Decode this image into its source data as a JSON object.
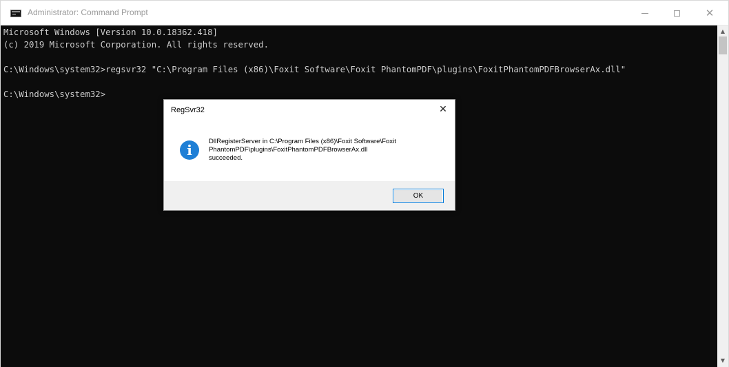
{
  "window": {
    "title": "Administrator: Command Prompt",
    "icon": "cmd-icon",
    "controls": {
      "minimize": "minimize-icon",
      "maximize": "maximize-icon",
      "close": "close-icon"
    }
  },
  "console": {
    "lines": [
      "Microsoft Windows [Version 10.0.18362.418]",
      "(c) 2019 Microsoft Corporation. All rights reserved.",
      "",
      "C:\\Windows\\system32>regsvr32 \"C:\\Program Files (x86)\\Foxit Software\\Foxit PhantomPDF\\plugins\\FoxitPhantomPDFBrowserAx.dll\"",
      "",
      "C:\\Windows\\system32>"
    ],
    "background": "#0c0c0c",
    "foreground": "#cccccc"
  },
  "dialog": {
    "title": "RegSvr32",
    "icon": "info-icon",
    "icon_glyph": "i",
    "icon_color": "#1e7fd6",
    "message_lines": [
      "DllRegisterServer in C:\\Program Files (x86)\\Foxit Software\\Foxit",
      "PhantomPDF\\plugins\\FoxitPhantomPDFBrowserAx.dll",
      "succeeded."
    ],
    "ok_label": "OK",
    "close_glyph": "✕",
    "accent": "#0078d7"
  }
}
